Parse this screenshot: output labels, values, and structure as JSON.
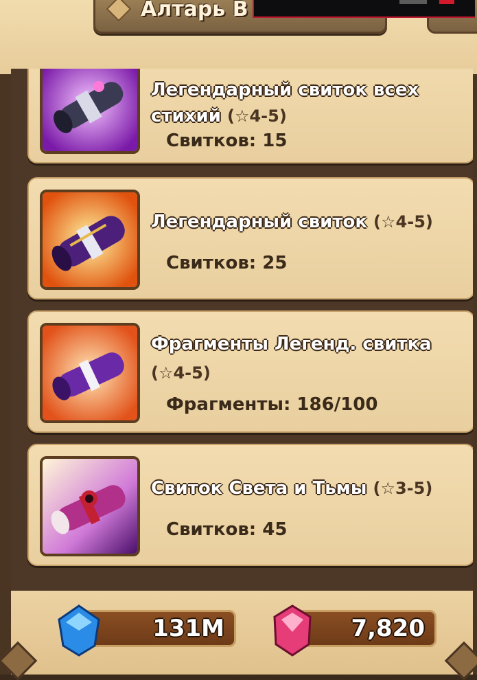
{
  "header": {
    "title": "Алтарь В"
  },
  "cards": [
    {
      "name_line1": "Легендарный свиток всех",
      "name_line2": "стихий",
      "stars": "(☆4-5)",
      "count": "Свитков: 15",
      "icon": "all-elements-scroll-icon"
    },
    {
      "name": "Легендарный свиток",
      "stars": "(☆4-5)",
      "count": "Свитков: 25",
      "icon": "legendary-scroll-icon"
    },
    {
      "name": "Фрагменты Легенд. свитка",
      "stars": "(☆4-5)",
      "count": "Фрагменты: 186/100",
      "icon": "legendary-fragment-icon"
    },
    {
      "name": "Свиток Света и Тьмы",
      "stars": "(☆3-5)",
      "count": "Свитков: 45",
      "icon": "light-dark-scroll-icon"
    }
  ],
  "currency": {
    "mana": "131M",
    "crystals": "7,820"
  },
  "colors": {
    "card_bg": "#f2dcb0",
    "frame": "#4a3422",
    "pill": "#8a4e22"
  }
}
